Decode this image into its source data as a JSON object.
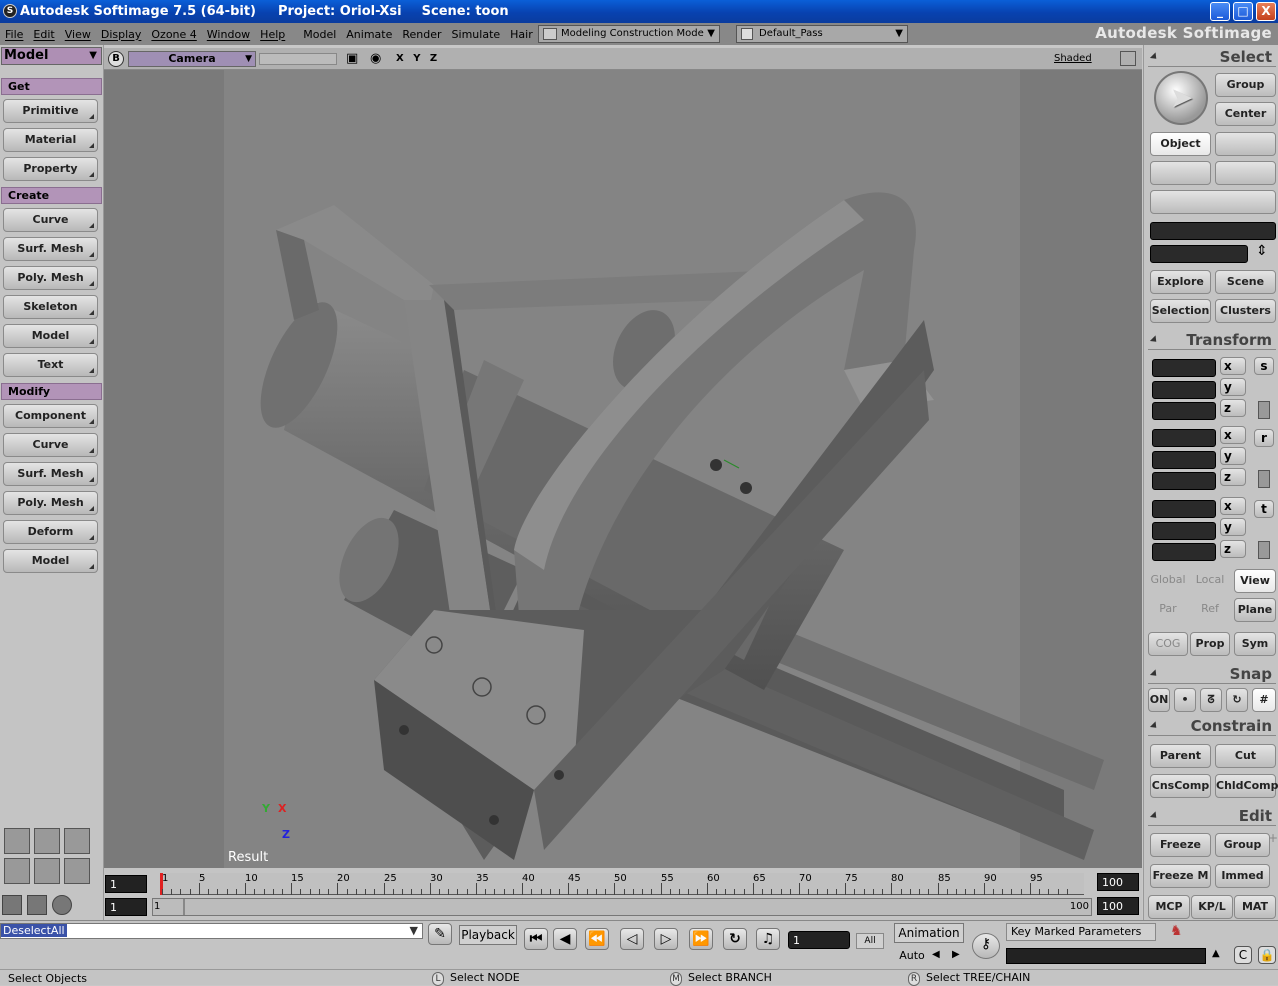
{
  "title": {
    "app": "Autodesk Softimage 7.5 (64-bit)",
    "project": "Project: Oriol-Xsi",
    "scene": "Scene: toon"
  },
  "window_controls": {
    "minimize": "_",
    "maximize": "□",
    "close": "X"
  },
  "menu": [
    "File",
    "Edit",
    "View",
    "Display",
    "Ozone 4",
    "Window",
    "Help",
    "Model",
    "Animate",
    "Render",
    "Simulate",
    "Hair"
  ],
  "construction_mode": "Modeling Construction Mode",
  "pass": "Default_Pass",
  "brand": "Autodesk Softimage",
  "left": {
    "header": "Model",
    "sections": [
      {
        "title": "Get",
        "items": [
          "Primitive",
          "Material",
          "Property"
        ]
      },
      {
        "title": "Create",
        "items": [
          "Curve",
          "Surf. Mesh",
          "Poly. Mesh",
          "Skeleton",
          "Model",
          "Text"
        ]
      },
      {
        "title": "Modify",
        "items": [
          "Component",
          "Curve",
          "Surf. Mesh",
          "Poly. Mesh",
          "Deform",
          "Model"
        ]
      }
    ]
  },
  "viewport": {
    "badge": "B",
    "camera": "Camera",
    "axes_label": "X Y Z",
    "shading": "Shaded",
    "result_label": "Result",
    "axis_gizmo": {
      "y": "Y",
      "x": "X",
      "z": "Z"
    }
  },
  "timeline": {
    "start": "1",
    "end": "100",
    "range_start": "1",
    "range_end": "100",
    "range_end_label": "100",
    "current_frame": 1,
    "ticks": [
      "1",
      "5",
      "10",
      "15",
      "20",
      "25",
      "30",
      "35",
      "40",
      "45",
      "50",
      "55",
      "60",
      "65",
      "70",
      "75",
      "80",
      "85",
      "90",
      "95"
    ],
    "range_left_label": "1"
  },
  "right": {
    "select_title": "Select",
    "group": "Group",
    "center": "Center",
    "object": "Object",
    "explore": "Explore",
    "scene": "Scene",
    "selection": "Selection",
    "clusters": "Clusters",
    "transform_title": "Transform",
    "axes": [
      "x",
      "y",
      "z"
    ],
    "side_s": "s",
    "side_r": "r",
    "side_t": "t",
    "global": "Global",
    "local": "Local",
    "view": "View",
    "par": "Par",
    "ref": "Ref",
    "plane": "Plane",
    "cog": "COG",
    "prop": "Prop",
    "sym": "Sym",
    "snap_title": "Snap",
    "on": "ON",
    "constrain_title": "Constrain",
    "parent": "Parent",
    "cut": "Cut",
    "cnscomp": "CnsComp",
    "chldcomp": "ChldComp",
    "edit_title": "Edit",
    "freeze": "Freeze",
    "group2": "Group",
    "freeze_m": "Freeze M",
    "immed": "Immed",
    "tabs": [
      "MCP",
      "KP/L",
      "MAT"
    ]
  },
  "bottom": {
    "command": "DeselectAll",
    "playback": "Playback",
    "frame_field": "1",
    "all": "All",
    "animation": "Animation",
    "auto": "Auto",
    "key_marked": "Key Marked Parameters",
    "status_left": "Select Objects",
    "mouse_l_key": "L",
    "mouse_l": "Select NODE",
    "mouse_m_key": "M",
    "mouse_m": "Select BRANCH",
    "mouse_r_key": "R",
    "mouse_r": "Select TREE/CHAIN"
  }
}
